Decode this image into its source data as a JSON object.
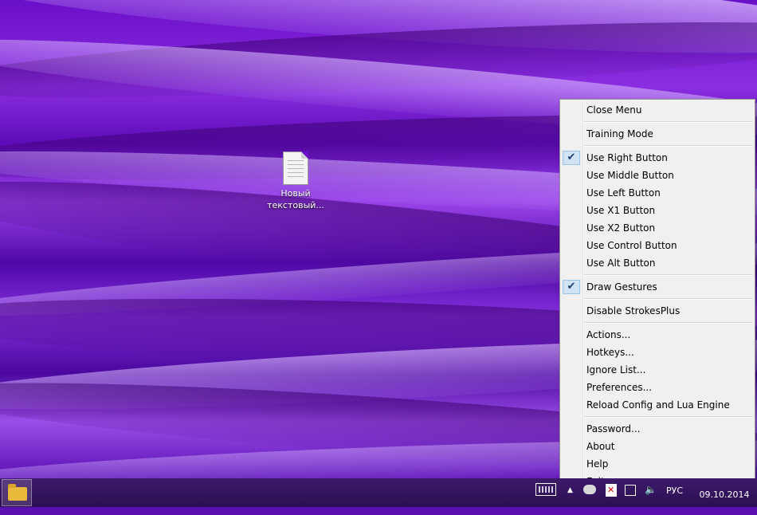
{
  "desktop": {
    "icon": {
      "label_line1": "Новый",
      "label_line2": "текстовый..."
    }
  },
  "menu": {
    "groups": [
      [
        {
          "label": "Close Menu",
          "checked": false
        }
      ],
      [
        {
          "label": "Training Mode",
          "checked": false
        }
      ],
      [
        {
          "label": "Use Right Button",
          "checked": true
        },
        {
          "label": "Use Middle Button",
          "checked": false
        },
        {
          "label": "Use Left Button",
          "checked": false
        },
        {
          "label": "Use X1 Button",
          "checked": false
        },
        {
          "label": "Use X2 Button",
          "checked": false
        },
        {
          "label": "Use Control Button",
          "checked": false
        },
        {
          "label": "Use Alt Button",
          "checked": false
        }
      ],
      [
        {
          "label": "Draw Gestures",
          "checked": true
        }
      ],
      [
        {
          "label": "Disable StrokesPlus",
          "checked": false
        }
      ],
      [
        {
          "label": "Actions...",
          "checked": false
        },
        {
          "label": "Hotkeys...",
          "checked": false
        },
        {
          "label": "Ignore List...",
          "checked": false
        },
        {
          "label": "Preferences...",
          "checked": false
        },
        {
          "label": "Reload Config and Lua Engine",
          "checked": false
        }
      ],
      [
        {
          "label": "Password...",
          "checked": false
        },
        {
          "label": "About",
          "checked": false
        },
        {
          "label": "Help",
          "checked": false
        },
        {
          "label": "Exit",
          "checked": false
        }
      ]
    ]
  },
  "taskbar": {
    "tray": {
      "language": "РУС",
      "date": "09.10.2014",
      "up_arrow": "▲",
      "volume": "🔈"
    }
  }
}
